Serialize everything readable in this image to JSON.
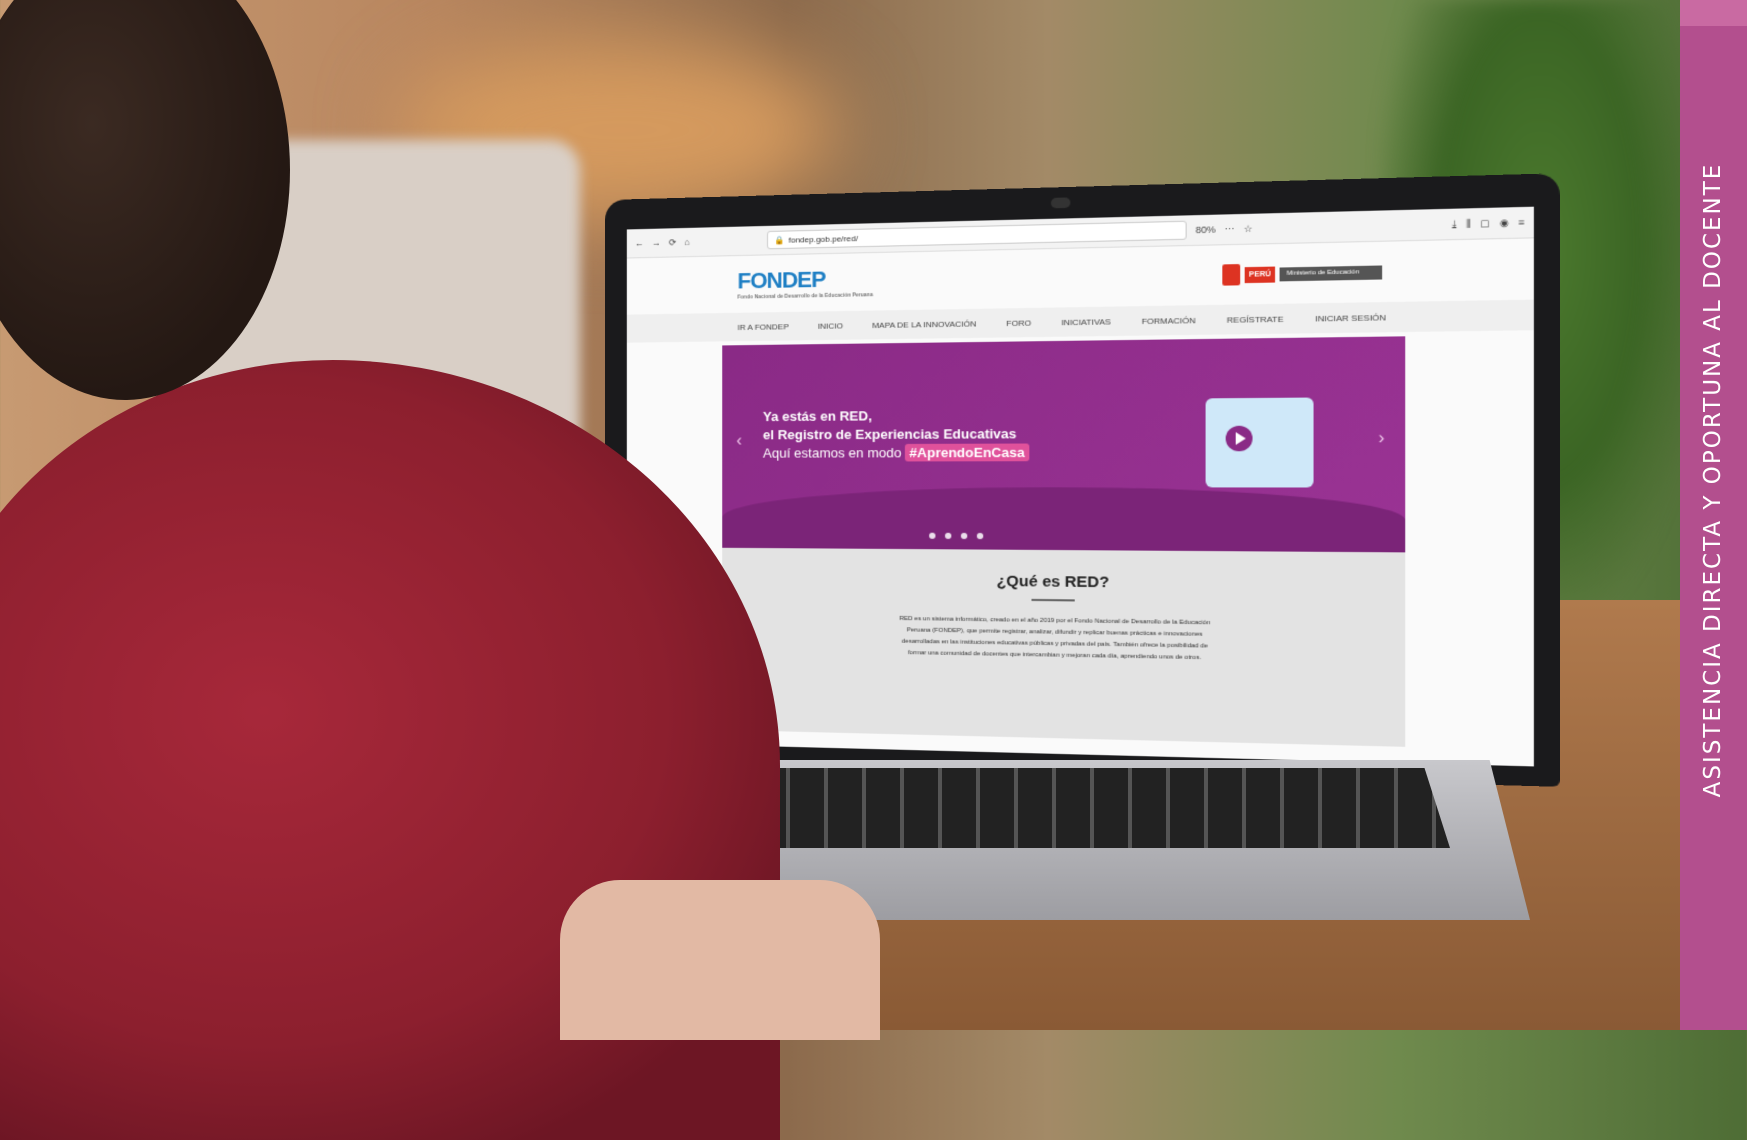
{
  "browser": {
    "url": "fondep.gob.pe/red/",
    "zoom": "80%"
  },
  "site": {
    "logo": "FONDEP",
    "logo_sub": "Fondo Nacional de Desarrollo de la Educación Peruana",
    "minedu_country": "PERÚ",
    "minedu_name": "Ministerio de Educación",
    "nav": [
      "IR A FONDEP",
      "INICIO",
      "MAPA DE LA INNOVACIÓN",
      "FORO",
      "INICIATIVAS",
      "FORMACIÓN",
      "REGÍSTRATE",
      "INICIAR SESIÓN"
    ],
    "banner_line1": "Ya estás en RED,",
    "banner_line2": "el Registro de Experiencias Educativas",
    "banner_mode": "Aquí estamos en modo",
    "banner_hashtag": "#AprendoEnCasa",
    "about_title": "¿Qué es RED?",
    "about_text": "RED es un sistema informático, creado en el año 2019 por el Fondo Nacional de Desarrollo de la Educación Peruana (FONDEP), que permite registrar, analizar, difundir y replicar buenas prácticas e innovaciones desarrolladas en las instituciones educativas públicas y privadas del país. También ofrece la posibilidad de formar una comunidad de docentes que intercambian y mejoran cada día, aprendiendo unos de otros."
  },
  "side_band": {
    "text": "ASISTENCIA DIRECTA Y OPORTUNA AL DOCENTE",
    "color": "#b34f8e"
  }
}
